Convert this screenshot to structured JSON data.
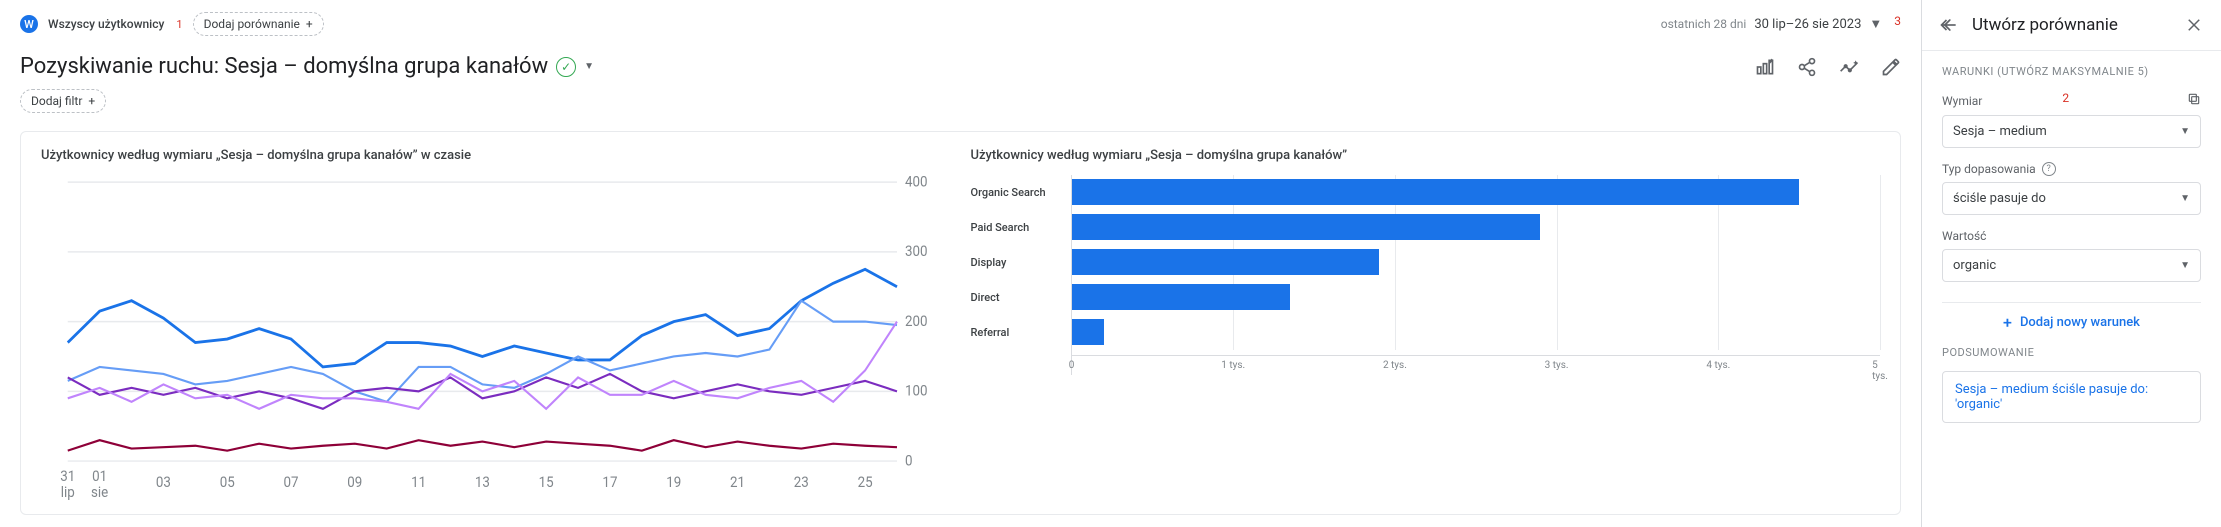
{
  "topbar": {
    "audience_label": "Wszyscy użytkownicy",
    "note1": "1",
    "add_comparison": "Dodaj porównanie",
    "date_muted": "ostatnich 28 dni",
    "date_range": "30 lip–26 sie 2023",
    "note3": "3"
  },
  "title": {
    "text": "Pozyskiwanie ruchu: Sesja – domyślna grupa kanałów"
  },
  "filter": {
    "add_filter": "Dodaj filtr"
  },
  "charts": {
    "line_title": "Użytkownicy według wymiaru „Sesja – domyślna grupa kanałów” w czasie",
    "bar_title": "Użytkownicy według wymiaru „Sesja – domyślna grupa kanałów”"
  },
  "side": {
    "title": "Utwórz porównanie",
    "conditions_label": "WARUNKI (UTWÓRZ MAKSYMALNIE 5)",
    "note2": "2",
    "dim_label": "Wymiar",
    "dim_value": "Sesja – medium",
    "match_label": "Typ dopasowania",
    "match_value": "ściśle pasuje do",
    "value_label": "Wartość",
    "value_value": "organic",
    "add_cond": "Dodaj nowy warunek",
    "summary_label": "PODSUMOWANIE",
    "summary_text": "Sesja – medium ściśle pasuje do: 'organic'"
  },
  "chart_data": [
    {
      "type": "line",
      "title": "Użytkownicy według wymiaru „Sesja – domyślna grupa kanałów” w czasie",
      "xlabel": "",
      "ylabel": "",
      "ylim": [
        0,
        400
      ],
      "x_ticks": [
        "31 lip",
        "01 sie",
        "03",
        "05",
        "07",
        "09",
        "11",
        "13",
        "15",
        "17",
        "19",
        "21",
        "23",
        "25"
      ],
      "y_ticks": [
        0,
        100,
        200,
        300,
        400
      ],
      "series": [
        {
          "name": "Organic Search",
          "values": [
            170,
            215,
            230,
            205,
            170,
            175,
            190,
            175,
            135,
            140,
            170,
            170,
            165,
            150,
            165,
            155,
            145,
            145,
            180,
            200,
            210,
            180,
            190,
            230,
            255,
            275,
            250
          ]
        },
        {
          "name": "Paid Search",
          "values": [
            115,
            135,
            130,
            125,
            110,
            115,
            125,
            135,
            125,
            100,
            85,
            135,
            135,
            110,
            105,
            125,
            150,
            130,
            140,
            150,
            155,
            150,
            160,
            230,
            200,
            200,
            195
          ]
        },
        {
          "name": "Display",
          "values": [
            120,
            95,
            105,
            95,
            105,
            90,
            100,
            90,
            75,
            100,
            105,
            100,
            120,
            90,
            100,
            120,
            105,
            125,
            100,
            90,
            100,
            110,
            100,
            95,
            105,
            115,
            100
          ]
        },
        {
          "name": "Direct",
          "values": [
            90,
            105,
            85,
            110,
            90,
            95,
            75,
            95,
            90,
            90,
            85,
            75,
            125,
            100,
            115,
            75,
            120,
            95,
            95,
            115,
            95,
            90,
            105,
            115,
            85,
            130,
            200
          ]
        },
        {
          "name": "Referral",
          "values": [
            15,
            30,
            18,
            20,
            22,
            15,
            25,
            18,
            22,
            25,
            18,
            30,
            22,
            28,
            20,
            28,
            25,
            22,
            15,
            30,
            20,
            28,
            22,
            18,
            25,
            22,
            20
          ]
        }
      ]
    },
    {
      "type": "bar",
      "orientation": "horizontal",
      "title": "Użytkownicy według wymiaru „Sesja – domyślna grupa kanałów”",
      "xlabel": "",
      "ylabel": "",
      "xlim": [
        0,
        5000
      ],
      "x_ticks": [
        "0",
        "1 tys.",
        "2 tys.",
        "3 tys.",
        "4 tys.",
        "5 tys."
      ],
      "categories": [
        "Organic Search",
        "Paid Search",
        "Display",
        "Direct",
        "Referral"
      ],
      "values": [
        4500,
        2900,
        1900,
        1350,
        200
      ]
    }
  ]
}
